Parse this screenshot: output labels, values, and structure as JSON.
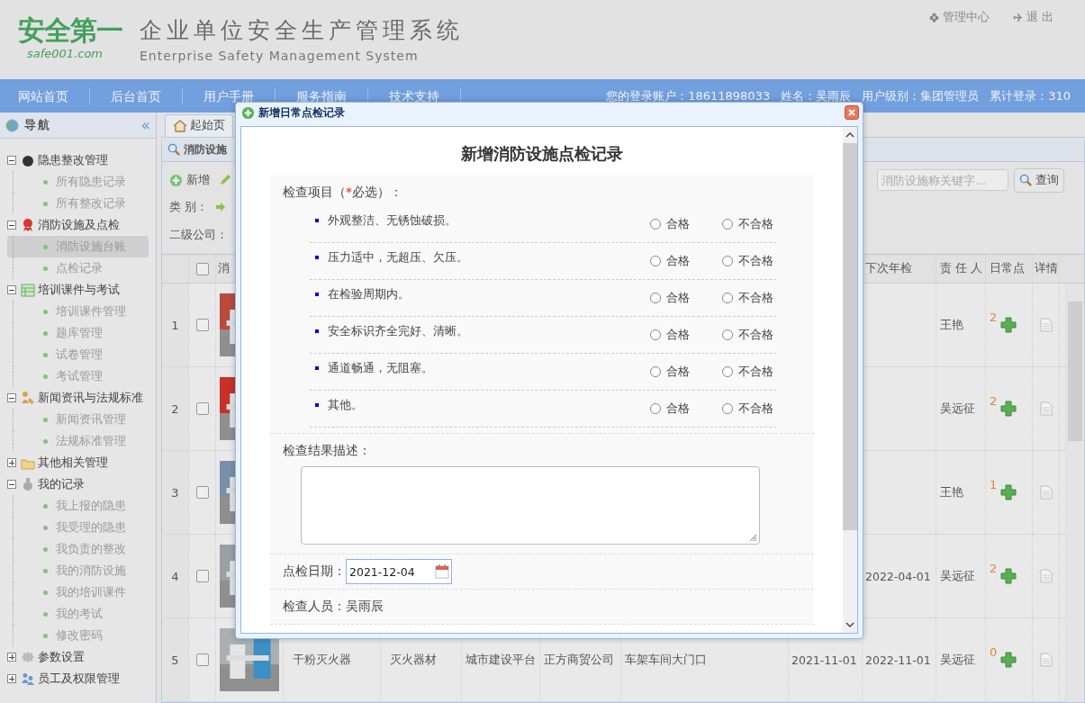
{
  "header": {
    "logo": "安全第一",
    "logo_sub": "safe001.com",
    "title": "企业单位安全生产管理系统",
    "subtitle": "Enterprise Safety Management System",
    "links": [
      "管理中心",
      "退 出"
    ]
  },
  "nav": {
    "items": [
      "网站首页",
      "后台首页",
      "用户手册",
      "服务指南",
      "技术支持"
    ],
    "user_info": [
      "您的登录账户：18611898033",
      "姓名：吴雨辰",
      "用户级别：集团管理员",
      "累计登录：310"
    ]
  },
  "sidebar": {
    "title": "导航",
    "collapse": "«",
    "groups": [
      {
        "label": "隐患整改管理",
        "expanded": true,
        "children": [
          {
            "label": "所有隐患记录",
            "selected": false
          },
          {
            "label": "所有整改记录",
            "selected": false
          }
        ]
      },
      {
        "label": "消防设施及点检",
        "expanded": true,
        "children": [
          {
            "label": "消防设施台账",
            "selected": true
          },
          {
            "label": "点检记录",
            "selected": false
          }
        ]
      },
      {
        "label": "培训课件与考试",
        "expanded": true,
        "children": [
          {
            "label": "培训课件管理",
            "selected": false
          },
          {
            "label": "题库管理",
            "selected": false
          },
          {
            "label": "试卷管理",
            "selected": false
          },
          {
            "label": "考试管理",
            "selected": false
          }
        ]
      },
      {
        "label": "新闻资讯与法规标准",
        "expanded": true,
        "children": [
          {
            "label": "新闻资讯管理",
            "selected": false
          },
          {
            "label": "法规标准管理",
            "selected": false
          }
        ]
      },
      {
        "label": "其他相关管理",
        "expanded": false
      },
      {
        "label": "我的记录",
        "expanded": true,
        "children": [
          {
            "label": "我上报的隐患",
            "selected": false
          },
          {
            "label": "我受理的隐患",
            "selected": false
          },
          {
            "label": "我负责的整改",
            "selected": false
          },
          {
            "label": "我的消防设施",
            "selected": false
          },
          {
            "label": "我的培训课件",
            "selected": false
          },
          {
            "label": "我的考试",
            "selected": false
          },
          {
            "label": "修改密码",
            "selected": false
          }
        ]
      },
      {
        "label": "参数设置",
        "expanded": false
      },
      {
        "label": "员工及权限管理",
        "expanded": false
      }
    ]
  },
  "tabs": [
    {
      "label": "起始页",
      "selected": false
    }
  ],
  "panel_title": "消防设施",
  "toolbar": {
    "add": "新增",
    "category_label": "类 别：",
    "company_label": "二级公司：",
    "search": {
      "placeholder": "消防设施称关键字..."
    },
    "search_button": "查询"
  },
  "table": {
    "all_checked": false,
    "columns": {
      "name": "消",
      "next": "下次年检",
      "person": "责 任 人",
      "count": "日常点",
      "detail": "详情"
    },
    "rows": [
      {
        "num": "1",
        "checked": false,
        "next": "",
        "person": "王艳",
        "count": "2"
      },
      {
        "num": "2",
        "checked": false,
        "next": "",
        "person": "吴远征",
        "count": "2"
      },
      {
        "num": "3",
        "checked": false,
        "next": "",
        "person": "王艳",
        "count": "1"
      },
      {
        "num": "4",
        "checked": false,
        "next": "2022-04-01",
        "person": "吴远征",
        "count": "2"
      },
      {
        "num": "5",
        "checked": false,
        "name": "干粉灭火器",
        "type": "灭火器材",
        "platform": "城市建设平台",
        "company": "正方商贸公司",
        "location": "车架车间大门口",
        "annual": "2021-11-01",
        "next": "2022-11-01",
        "person": "吴远征",
        "count": "0"
      }
    ]
  },
  "dialog": {
    "title": "新增日常点检记录",
    "heading": "新增消防设施点检记录",
    "items_label": {
      "before": "检查项目（",
      "required": "*",
      "after": "必选）："
    },
    "items": [
      {
        "text": "外观整洁、无锈蚀破损。",
        "options": [
          {
            "label": "合格",
            "checked": false
          },
          {
            "label": "不合格",
            "checked": false
          }
        ]
      },
      {
        "text": "压力适中，无超压、欠压。",
        "options": [
          {
            "label": "合格",
            "checked": false
          },
          {
            "label": "不合格",
            "checked": false
          }
        ]
      },
      {
        "text": "在检验周期内。",
        "options": [
          {
            "label": "合格",
            "checked": false
          },
          {
            "label": "不合格",
            "checked": false
          }
        ]
      },
      {
        "text": "安全标识齐全完好、清晰。",
        "options": [
          {
            "label": "合格",
            "checked": false
          },
          {
            "label": "不合格",
            "checked": false
          }
        ]
      },
      {
        "text": "通道畅通，无阻塞。",
        "options": [
          {
            "label": "合格",
            "checked": false
          },
          {
            "label": "不合格",
            "checked": false
          }
        ]
      },
      {
        "text": "其他。",
        "options": [
          {
            "label": "合格",
            "checked": false
          },
          {
            "label": "不合格",
            "checked": false
          }
        ]
      }
    ],
    "result_label": "检查结果描述：",
    "date_label": "点检日期：",
    "date": "2021-12-04",
    "inspector": "检查人员：吴雨辰"
  }
}
